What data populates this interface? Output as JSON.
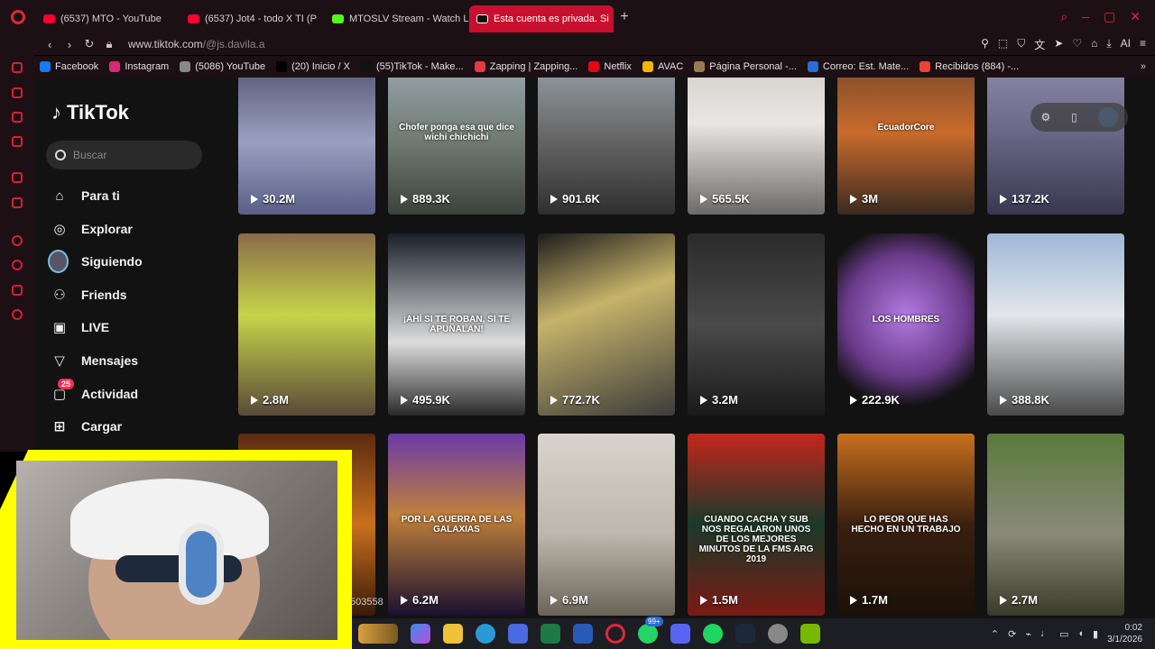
{
  "browser": {
    "tabs": [
      {
        "label": "(6537) MTO - YouTube",
        "fav": "yt",
        "active": false
      },
      {
        "label": "(6537) Jot4 - todo X TI (P",
        "fav": "yt",
        "active": false
      },
      {
        "label": "MTOSLV Stream - Watch L",
        "fav": "kick",
        "active": false
      },
      {
        "label": "Esta cuenta es privada. Si",
        "fav": "tt",
        "active": true
      }
    ],
    "url_host": "www.tiktok.com",
    "url_path": "/@js.davila.a",
    "new_tab": "+",
    "ai_label": "AI"
  },
  "bookmarks": [
    {
      "label": "Facebook",
      "color": "#1877f2"
    },
    {
      "label": "Instagram",
      "color": "#d62976"
    },
    {
      "label": "(5086) YouTube",
      "color": "#888888"
    },
    {
      "label": "(20) Inicio / X",
      "color": "#000000"
    },
    {
      "label": "(55)TikTok - Make...",
      "color": "#111111"
    },
    {
      "label": "Zapping | Zapping...",
      "color": "#e63946"
    },
    {
      "label": "Netflix",
      "color": "#e50914"
    },
    {
      "label": "AVAC",
      "color": "#f4b400"
    },
    {
      "label": "Página Personal -...",
      "color": "#9a7b4f"
    },
    {
      "label": "Correo: Est. Mate...",
      "color": "#2a6cd6"
    },
    {
      "label": "Recibidos (884) -...",
      "color": "#ea4335"
    }
  ],
  "tiktok": {
    "logo": "TikTok",
    "search_placeholder": "Buscar",
    "nav": [
      {
        "label": "Para ti",
        "icon": "home-icon",
        "glyph": "⌂"
      },
      {
        "label": "Explorar",
        "icon": "compass-icon",
        "glyph": "◎"
      },
      {
        "label": "Siguiendo",
        "icon": "avatar",
        "glyph": ""
      },
      {
        "label": "Friends",
        "icon": "friends-icon",
        "glyph": "⚇"
      },
      {
        "label": "LIVE",
        "icon": "live-icon",
        "glyph": "▣"
      },
      {
        "label": "Mensajes",
        "icon": "messages-icon",
        "glyph": "▽"
      },
      {
        "label": "Actividad",
        "icon": "activity-icon",
        "glyph": "▢",
        "badge": "25"
      },
      {
        "label": "Cargar",
        "icon": "upload-icon",
        "glyph": "⊞"
      }
    ],
    "videos": [
      {
        "views": "30.2M",
        "caption": "",
        "bg": "linear-gradient(180deg,#3a3a55,#9aa0c0 60%,#5b5f88)"
      },
      {
        "views": "889.3K",
        "caption": "Chofer ponga esa que dice wichi chichichi",
        "bg": "linear-gradient(180deg,#a9b6c2,#6f7a72 60%,#3c423c)"
      },
      {
        "views": "901.6K",
        "caption": "",
        "bg": "linear-gradient(180deg,#a6b3bf,#6a6a6a 55%,#2f2f2f)"
      },
      {
        "views": "565.5K",
        "caption": "",
        "bg": "linear-gradient(180deg,#c9c3bd,#e9e6e4 50%,#6b6a68)"
      },
      {
        "views": "3M",
        "caption": "EcuadorCore",
        "bg": "linear-gradient(180deg,#5a3b2a,#c96b2c 55%,#3a2a20)"
      },
      {
        "views": "137.2K",
        "caption": "",
        "bg": "linear-gradient(180deg,#9b97b8,#6a6787 55%,#3a3850)"
      },
      {
        "views": "2.8M",
        "caption": "",
        "bg": "linear-gradient(180deg,#8a6b4a,#c6d44a 45%,#5a4a38)"
      },
      {
        "views": "495.9K",
        "caption": "¡AHÍ SI TE ROBAN, SI TE APUÑALAN!",
        "bg": "linear-gradient(180deg,#1a1f2a,#dcdcdc 60%,#2a2a2a)"
      },
      {
        "views": "772.7K",
        "caption": "",
        "bg": "linear-gradient(160deg,#1c1c1c,#c6b36a 40%,#3b3b3b)"
      },
      {
        "views": "3.2M",
        "caption": "",
        "bg": "linear-gradient(180deg,#2b2b2b,#4a4a4a 50%,#1a1a1a)"
      },
      {
        "views": "222.9K",
        "caption": "LOS HOMBRES",
        "bg": "radial-gradient(circle at 50% 45%,#b27ae0,#6a3a8a 50%,#121212 75%)"
      },
      {
        "views": "388.8K",
        "caption": "",
        "bg": "linear-gradient(180deg,#9fb8d8,#e2e6ea 45%,#4a4a4a)"
      },
      {
        "views": "",
        "caption": "",
        "bg": "linear-gradient(180deg,#5a2a10,#c9701e 50%,#3a1a08)"
      },
      {
        "views": "6.2M",
        "caption": "POR LA GUERRA DE LAS GALAXIAS",
        "bg": "linear-gradient(180deg,#6a3aa8,#c0803a 45%,#1a1030)"
      },
      {
        "views": "6.9M",
        "caption": "",
        "bg": "linear-gradient(180deg,#d8d4cc,#bdb7ad 55%,#6a6458)"
      },
      {
        "views": "1.5M",
        "caption": "CUANDO CACHA Y SUB NOS REGALARON UNOS DE LOS MEJORES MINUTOS DE LA FMS ARG 2019",
        "bg": "linear-gradient(180deg,#c4261c,#1a3a2a 50%,#7a1a14)"
      },
      {
        "views": "1.7M",
        "caption": "LO PEOR QUE HAS HECHO EN UN TRABAJO",
        "bg": "linear-gradient(180deg,#c9701e,#3a2010 50%,#1a1008)"
      },
      {
        "views": "2.7M",
        "caption": "",
        "bg": "linear-gradient(180deg,#5a7a3a,#8a8a7a 55%,#3a3a2a)"
      }
    ]
  },
  "webcam": {
    "overlay_text": "503558"
  },
  "taskbar": {
    "badge": "99+",
    "time": "0:02",
    "date": "3/1/2026"
  }
}
